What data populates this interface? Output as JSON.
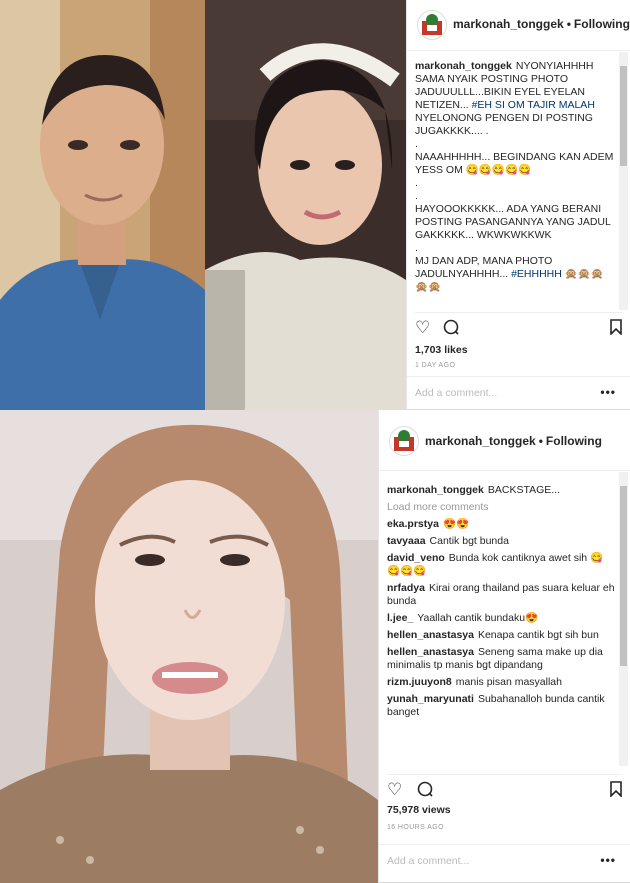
{
  "post1": {
    "username": "markonah_tonggek",
    "following_label": "Following",
    "caption_user": "markonah_tonggek",
    "caption": [
      "NYONYIAHHHH SAMA NYAIK POSTING PHOTO JADUUULLL...BIKIN EYEL EYELAN NETIZEN... ",
      "#EH SI OM TAJIR MALAH",
      " NYELONONG PENGEN DI POSTING JUGAKKKK.... .",
      ".",
      "NAAAHHHHH... BEGINDANG KAN ADEM YESS OM 😋😋😋😋😋",
      ".",
      ".",
      "HAYOOOKKKKK... ADA YANG BERANI POSTING PASANGANNYA YANG JADUL GAKKKKK... WKWKWKKWK",
      ".",
      "MJ DAN ADP, MANA PHOTO JADULNYAHHHH... ",
      "#EHHHHH",
      " 🙊🙊🙊🙊🙊"
    ],
    "likes": "1,703 likes",
    "time": "1 DAY AGO",
    "add_comment_placeholder": "Add a comment...",
    "more_label": "•••"
  },
  "post2": {
    "username": "markonah_tonggek",
    "following_label": "Following",
    "caption_user": "markonah_tonggek",
    "caption": "BACKSTAGE...",
    "load_more": "Load more comments",
    "comments": [
      {
        "user": "eka.prstya",
        "text": "😍😍"
      },
      {
        "user": "tavyaaa",
        "text": "Cantik bgt bunda"
      },
      {
        "user": "david_veno",
        "text": "Bunda kok cantiknya awet sih 😋😋😋😋"
      },
      {
        "user": "nrfadya",
        "text": "Kirai orang thailand pas suara keluar eh bunda"
      },
      {
        "user": "l.jee_",
        "text": "Yaallah cantik bundaku😍"
      },
      {
        "user": "hellen_anastasya",
        "text": "Kenapa cantik bgt sih bun"
      },
      {
        "user": "hellen_anastasya",
        "text": "Seneng sama make up dia minimalis tp manis bgt dipandang"
      },
      {
        "user": "rizm.juuyon8",
        "text": "manis pisan masyallah"
      },
      {
        "user": "yunah_maryunati",
        "text": "Subahanalloh bunda cantik banget"
      }
    ],
    "views": "75,978 views",
    "time": "16 HOURS AGO",
    "add_comment_placeholder": "Add a comment...",
    "more_label": "•••"
  },
  "icons": {
    "heart": "heart-icon",
    "comment": "comment-icon",
    "bookmark": "bookmark-icon"
  }
}
